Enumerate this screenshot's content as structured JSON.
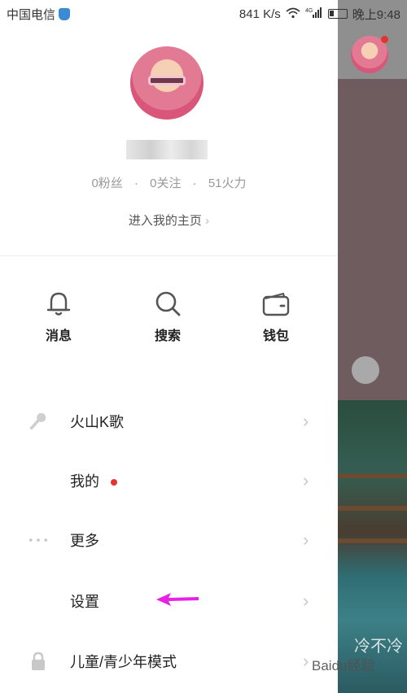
{
  "status_bar": {
    "carrier": "中国电信",
    "speed": "841 K/s",
    "network": "4G",
    "time": "晚上9:48"
  },
  "profile": {
    "stats": [
      "0粉丝",
      "0关注",
      "51火力"
    ],
    "stat_separator": "·",
    "homepage_link": "进入我的主页"
  },
  "quick_actions": [
    {
      "label": "消息",
      "icon": "bell-icon"
    },
    {
      "label": "搜索",
      "icon": "search-icon"
    },
    {
      "label": "钱包",
      "icon": "wallet-icon"
    }
  ],
  "menu": {
    "items": [
      {
        "label": "火山K歌",
        "icon": "microphone-icon"
      },
      {
        "label": "我的",
        "icon": "",
        "badge": "red-dot"
      },
      {
        "label": "更多",
        "icon": "more-dots-icon"
      },
      {
        "label": "设置",
        "icon": ""
      },
      {
        "label": "儿童/青少年模式",
        "icon": "lock-icon"
      }
    ],
    "chevron": "›"
  },
  "background": {
    "overlay_text": "冷不冷"
  },
  "watermark": "Baidu经验",
  "colors": {
    "accent_red": "#e3342f",
    "annotation_arrow": "#e622e6",
    "drawer_bg": "#ffffff",
    "muted_text": "#999999"
  }
}
